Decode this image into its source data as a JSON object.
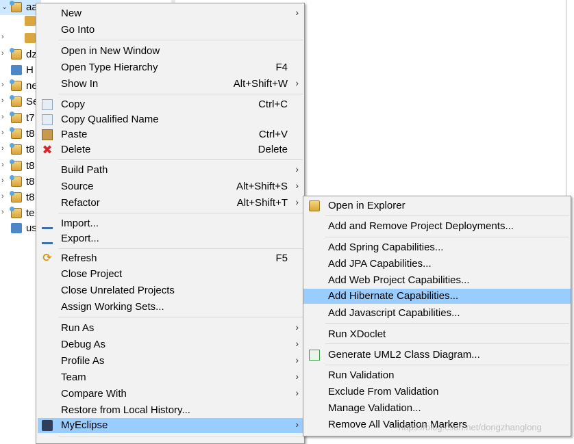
{
  "tree": {
    "items": [
      {
        "arrow": "⌄",
        "label": "aa",
        "icon": "project-icon",
        "selected": true
      },
      {
        "arrow": "",
        "label": "",
        "icon": "package-icon"
      },
      {
        "arrow": "›",
        "label": "",
        "icon": "package-icon"
      },
      {
        "arrow": "›",
        "label": "dz",
        "icon": "project-icon"
      },
      {
        "arrow": "",
        "label": "H",
        "icon": "folder-icon"
      },
      {
        "arrow": "›",
        "label": "ne",
        "icon": "project-icon"
      },
      {
        "arrow": "›",
        "label": "Se",
        "icon": "project-icon"
      },
      {
        "arrow": "›",
        "label": "t7",
        "icon": "project-icon"
      },
      {
        "arrow": "›",
        "label": "t8",
        "icon": "project-icon"
      },
      {
        "arrow": "›",
        "label": "t8",
        "icon": "project-icon"
      },
      {
        "arrow": "›",
        "label": "t8",
        "icon": "project-icon"
      },
      {
        "arrow": "›",
        "label": "t8",
        "icon": "project-icon"
      },
      {
        "arrow": "›",
        "label": "t8",
        "icon": "project-icon"
      },
      {
        "arrow": "›",
        "label": "te",
        "icon": "project-icon"
      },
      {
        "arrow": "",
        "label": "us",
        "icon": "folder-icon"
      }
    ]
  },
  "context_menu": {
    "new": "New",
    "go_into": "Go Into",
    "open_in_new_window": "Open in New Window",
    "open_type_hierarchy": "Open Type Hierarchy",
    "open_type_hierarchy_key": "F4",
    "show_in": "Show In",
    "show_in_key": "Alt+Shift+W",
    "copy": "Copy",
    "copy_key": "Ctrl+C",
    "copy_qualified_name": "Copy Qualified Name",
    "paste": "Paste",
    "paste_key": "Ctrl+V",
    "delete": "Delete",
    "delete_key": "Delete",
    "build_path": "Build Path",
    "source": "Source",
    "source_key": "Alt+Shift+S",
    "refactor": "Refactor",
    "refactor_key": "Alt+Shift+T",
    "import": "Import...",
    "export": "Export...",
    "refresh": "Refresh",
    "refresh_key": "F5",
    "close_project": "Close Project",
    "close_unrelated_projects": "Close Unrelated Projects",
    "assign_working_sets": "Assign Working Sets...",
    "run_as": "Run As",
    "debug_as": "Debug As",
    "profile_as": "Profile As",
    "team": "Team",
    "compare_with": "Compare With",
    "restore_from_local_history": "Restore from Local History...",
    "myeclipse": "MyEclipse",
    "submenu_arrow": "›"
  },
  "submenu": {
    "open_in_explorer": "Open in Explorer",
    "add_remove_deployments": "Add and Remove Project Deployments...",
    "add_spring": "Add Spring Capabilities...",
    "add_jpa": "Add JPA Capabilities...",
    "add_web_project": "Add Web Project Capabilities...",
    "add_hibernate": "Add Hibernate Capabilities...",
    "add_javascript": "Add Javascript Capabilities...",
    "run_xdoclet": "Run XDoclet",
    "generate_uml2": "Generate UML2 Class Diagram...",
    "run_validation": "Run Validation",
    "exclude_from_validation": "Exclude From Validation",
    "manage_validation": "Manage Validation...",
    "remove_validation_markers": "Remove All Validation Markers"
  },
  "watermark": "https://blog.csdn.net/dongzhanglong",
  "colors": {
    "highlight": "#99ccff",
    "menu_bg": "#f2f2f2",
    "selection": "#cde8ff"
  }
}
